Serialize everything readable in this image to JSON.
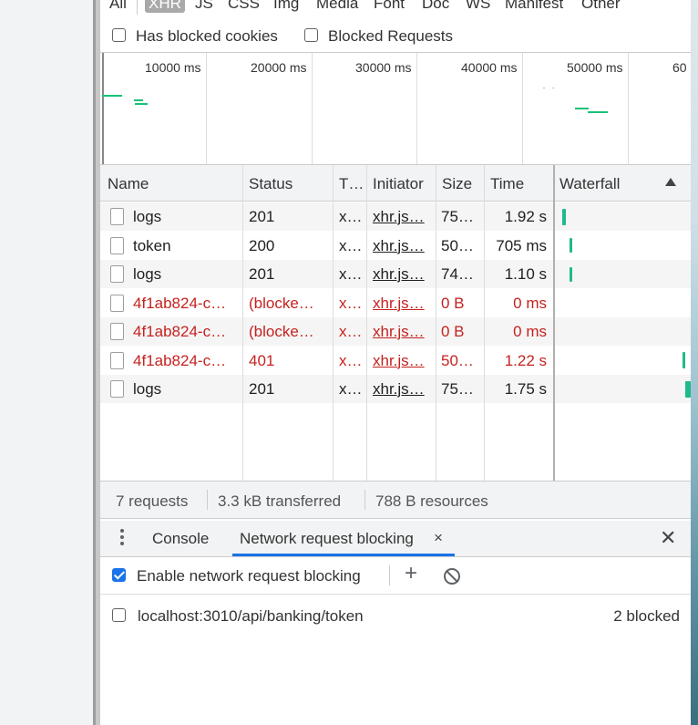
{
  "filters": {
    "items": [
      "All",
      "XHR",
      "JS",
      "CSS",
      "Img",
      "Media",
      "Font",
      "Doc",
      "WS",
      "Manifest",
      "Other"
    ],
    "active": "XHR"
  },
  "checkboxes": {
    "has_blocked_cookies": "Has blocked cookies",
    "blocked_requests": "Blocked Requests"
  },
  "overview": {
    "ticks": [
      "10000 ms",
      "20000 ms",
      "30000 ms",
      "40000 ms",
      "50000 ms",
      "60"
    ]
  },
  "table": {
    "headers": [
      "Name",
      "Status",
      "T…",
      "Initiator",
      "Size",
      "Time",
      "Waterfall"
    ],
    "rows": [
      {
        "name": "logs",
        "status": "201",
        "type": "x…",
        "initiator": "xhr.js…",
        "size": "75…",
        "time": "1.92 s",
        "error": false
      },
      {
        "name": "token",
        "status": "200",
        "type": "x…",
        "initiator": "xhr.js…",
        "size": "50…",
        "time": "705 ms",
        "error": false
      },
      {
        "name": "logs",
        "status": "201",
        "type": "x…",
        "initiator": "xhr.js…",
        "size": "74…",
        "time": "1.10 s",
        "error": false
      },
      {
        "name": "4f1ab824-c…",
        "status": "(blocke…",
        "type": "x…",
        "initiator": "xhr.js…",
        "size": "0 B",
        "time": "0 ms",
        "error": true
      },
      {
        "name": "4f1ab824-c…",
        "status": "(blocke…",
        "type": "x…",
        "initiator": "xhr.js…",
        "size": "0 B",
        "time": "0 ms",
        "error": true
      },
      {
        "name": "4f1ab824-c…",
        "status": "401",
        "type": "x…",
        "initiator": "xhr.js…",
        "size": "50…",
        "time": "1.22 s",
        "error": true
      },
      {
        "name": "logs",
        "status": "201",
        "type": "x…",
        "initiator": "xhr.js…",
        "size": "75…",
        "time": "1.75 s",
        "error": false
      }
    ]
  },
  "summary": {
    "requests": "7 requests",
    "transferred": "3.3 kB transferred",
    "resources": "788 B resources"
  },
  "drawer": {
    "console_tab": "Console",
    "blocking_tab": "Network request blocking",
    "close_tab_glyph": "×",
    "close_drawer_glyph": "✕",
    "enable_label": "Enable network request blocking",
    "enabled": true,
    "add_glyph": "+",
    "patterns": [
      {
        "url": "localhost:3010/api/banking/token",
        "blocked": "2 blocked",
        "checked": false
      }
    ]
  },
  "colors": {
    "accent": "#1a73e8",
    "error_text": "#c5221f",
    "waterfall_bar": "#1fba8c"
  }
}
